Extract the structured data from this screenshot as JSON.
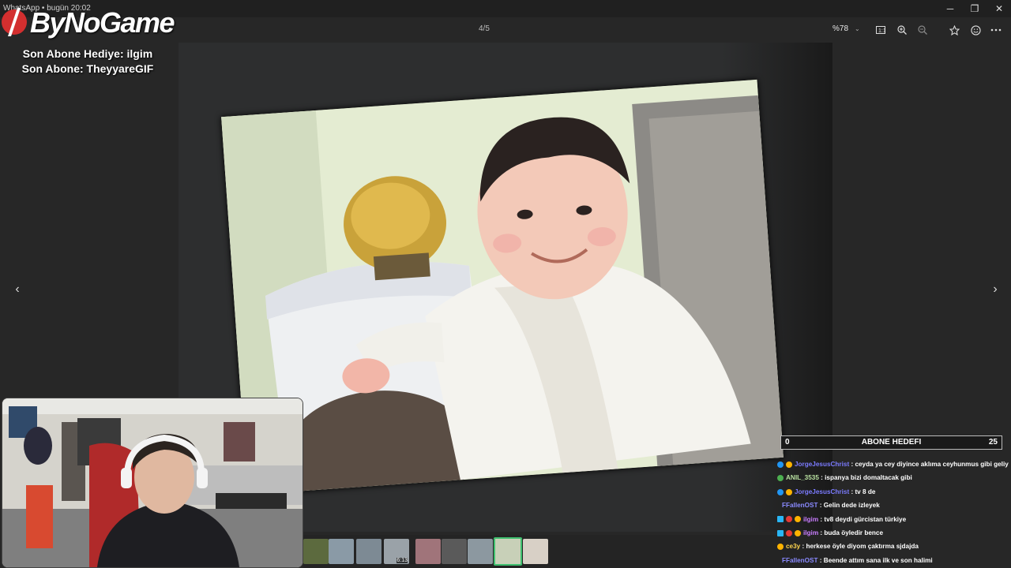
{
  "window": {
    "title": "WhatsApp • bugün 20:02",
    "minimize": "─",
    "maximize": "❐",
    "close": "✕"
  },
  "toolbar": {
    "counter": "4/5",
    "zoom": "%78",
    "icons": [
      "actual-size-icon",
      "zoom-in-icon",
      "zoom-out-icon",
      "star-icon",
      "smile-icon",
      "more-icon"
    ]
  },
  "overlay": {
    "logo": "ByNoGame",
    "last_gift": "Son Abone Hediye: ilgim",
    "last_sub": "Son Abone: TheyyareGIF"
  },
  "goal": {
    "left": "0",
    "title": "ABONE HEDEFI",
    "right": "25"
  },
  "thumbnails": {
    "video_duration": "6:13",
    "selected_index": 7,
    "count": 9
  },
  "chat": [
    {
      "user": "JorgeJesusChrist",
      "color": "#7b7bff",
      "msg": "ceyda ya cey diyince aklıma ceyhunmus gibi geliy",
      "badge": "#2196f3"
    },
    {
      "user": "ANIL_3535",
      "color": "#b8e0a0",
      "msg": "ispanya bizi domaltacak gibi",
      "badge": "#4caf50"
    },
    {
      "user": "JorgeJesusChrist",
      "color": "#7b7bff",
      "msg": "tv 8 de",
      "badge": "#2196f3"
    },
    {
      "user": "FFallenOST",
      "color": "#8a8aff",
      "msg": "Gelin dede izleyek",
      "badge": ""
    },
    {
      "user": "ilgim",
      "color": "#c87cff",
      "msg": "tv8 deydi gürcistan türkiye",
      "badge": "#29b6f6"
    },
    {
      "user": "ilgim",
      "color": "#c87cff",
      "msg": "buda öyledir bence",
      "badge": "#29b6f6"
    },
    {
      "user": "ce3y",
      "color": "#ffd54f",
      "msg": "herkese öyle diyom çaktırma sjdajda",
      "badge": "#ffb300"
    },
    {
      "user": "FFallenOST",
      "color": "#8a8aff",
      "msg": "Beende attım sana ilk ve son halimi",
      "badge": ""
    }
  ]
}
